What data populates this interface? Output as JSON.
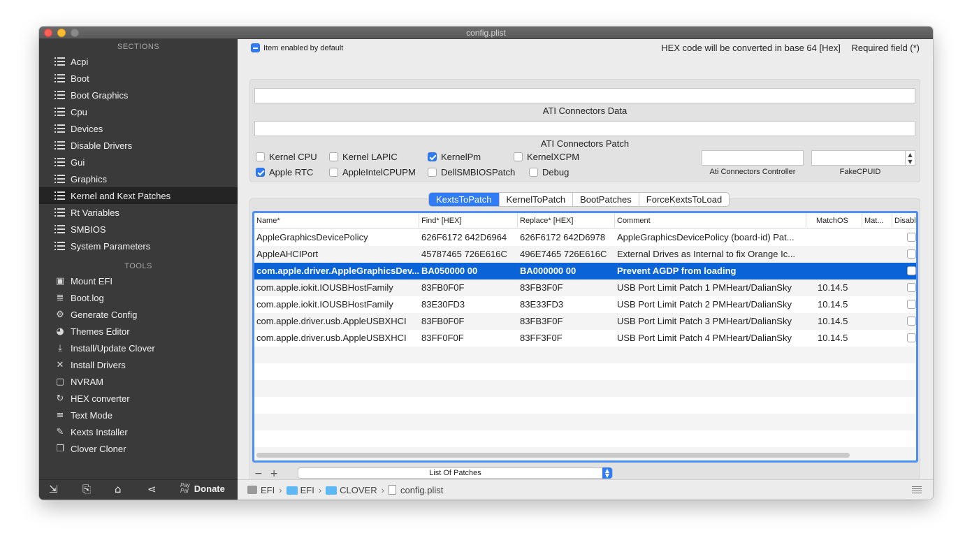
{
  "window": {
    "title": "config.plist"
  },
  "sidebar": {
    "sections_header": "SECTIONS",
    "sections": [
      {
        "label": "Acpi"
      },
      {
        "label": "Boot"
      },
      {
        "label": "Boot Graphics"
      },
      {
        "label": "Cpu"
      },
      {
        "label": "Devices"
      },
      {
        "label": "Disable Drivers"
      },
      {
        "label": "Gui"
      },
      {
        "label": "Graphics"
      },
      {
        "label": "Kernel and Kext Patches"
      },
      {
        "label": "Rt Variables"
      },
      {
        "label": "SMBIOS"
      },
      {
        "label": "System Parameters"
      }
    ],
    "active_section": "Kernel and Kext Patches",
    "tools_header": "TOOLS",
    "tools": [
      {
        "label": "Mount EFI",
        "icon": "disk-icon"
      },
      {
        "label": "Boot.log",
        "icon": "log-icon"
      },
      {
        "label": "Generate Config",
        "icon": "gears-icon"
      },
      {
        "label": "Themes Editor",
        "icon": "palette-icon"
      },
      {
        "label": "Install/Update Clover",
        "icon": "download-icon"
      },
      {
        "label": "Install Drivers",
        "icon": "tools-icon"
      },
      {
        "label": "NVRAM",
        "icon": "chip-icon"
      },
      {
        "label": "HEX converter",
        "icon": "refresh-icon"
      },
      {
        "label": "Text Mode",
        "icon": "text-icon"
      },
      {
        "label": "Kexts Installer",
        "icon": "kext-icon"
      },
      {
        "label": "Clover Cloner",
        "icon": "copy-icon"
      }
    ],
    "bottom": {
      "paypal_top": "Pay",
      "paypal_bottom": "Pal",
      "donate": "Donate"
    }
  },
  "header": {
    "item_enabled": "Item enabled by default",
    "hex_note": "HEX code will be converted in base 64 [Hex]",
    "required_note": "Required field (*)"
  },
  "kernel": {
    "ati_connectors_data_label": "ATI Connectors Data",
    "ati_connectors_data_value": "",
    "ati_connectors_patch_label": "ATI Connectors Patch",
    "ati_connectors_patch_value": "",
    "checkboxes": [
      {
        "label": "Kernel CPU",
        "checked": false
      },
      {
        "label": "Kernel LAPIC",
        "checked": false
      },
      {
        "label": "KernelPm",
        "checked": true
      },
      {
        "label": "KernelXCPM",
        "checked": false
      },
      {
        "label": "Apple RTC",
        "checked": true
      },
      {
        "label": "AppleIntelCPUPM",
        "checked": false
      },
      {
        "label": "DellSMBIOSPatch",
        "checked": false
      },
      {
        "label": "Debug",
        "checked": false
      }
    ],
    "ati_controller_label": "Ati Connectors Controller",
    "ati_controller_value": "",
    "fakecpuid_label": "FakeCPUID",
    "fakecpuid_value": ""
  },
  "tabs": [
    {
      "label": "KextsToPatch",
      "selected": true
    },
    {
      "label": "KernelToPatch",
      "selected": false
    },
    {
      "label": "BootPatches",
      "selected": false
    },
    {
      "label": "ForceKextsToLoad",
      "selected": false
    }
  ],
  "table": {
    "columns": [
      "Name*",
      "Find* [HEX]",
      "Replace* [HEX]",
      "Comment",
      "MatchOS",
      "Mat...",
      "Disabl"
    ],
    "rows": [
      {
        "name": "AppleGraphicsDevicePolicy",
        "find": "626F6172 642D6964",
        "replace": "626F6172 642D6978",
        "comment": "AppleGraphicsDevicePolicy (board-id) Pat...",
        "matchos": "",
        "selected": false
      },
      {
        "name": "AppleAHCIPort",
        "find": "45787465 726E616C",
        "replace": "496E7465 726E616C",
        "comment": "External Drives as Internal to fix Orange Ic...",
        "matchos": "",
        "selected": false
      },
      {
        "name": "com.apple.driver.AppleGraphicsDev...",
        "find": "BA050000 00",
        "replace": "BA000000 00",
        "comment": "Prevent AGDP from loading",
        "matchos": "",
        "selected": true
      },
      {
        "name": "com.apple.iokit.IOUSBHostFamily",
        "find": "83FB0F0F",
        "replace": "83FB3F0F",
        "comment": "USB Port Limit Patch 1 PMHeart/DalianSky",
        "matchos": "10.14.5",
        "selected": false
      },
      {
        "name": "com.apple.iokit.IOUSBHostFamily",
        "find": "83E30FD3",
        "replace": "83E33FD3",
        "comment": "USB Port Limit Patch 2 PMHeart/DalianSky",
        "matchos": "10.14.5",
        "selected": false
      },
      {
        "name": "com.apple.driver.usb.AppleUSBXHCI",
        "find": "83FB0F0F",
        "replace": "83FB3F0F",
        "comment": "USB Port Limit Patch 3 PMHeart/DalianSky",
        "matchos": "10.14.5",
        "selected": false
      },
      {
        "name": "com.apple.driver.usb.AppleUSBXHCI",
        "find": "83FF0F0F",
        "replace": "83FF3F0F",
        "comment": "USB Port Limit Patch 4 PMHeart/DalianSky",
        "matchos": "10.14.5",
        "selected": false
      }
    ],
    "list_popup": "List Of Patches"
  },
  "statusbar": {
    "breadcrumb": [
      "EFI",
      "EFI",
      "CLOVER",
      "config.plist"
    ]
  },
  "colors": {
    "accent": "#2f7cf6",
    "selection": "#0a64d8",
    "sidebar_bg": "#3a3a3a"
  }
}
